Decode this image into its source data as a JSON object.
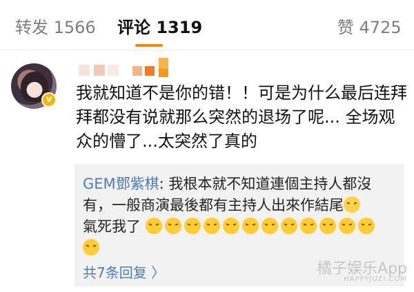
{
  "tabs": {
    "repost": "转发 1566",
    "comment": "评论 1319",
    "like": "赞 4725",
    "accent_color": "#ff8200"
  },
  "comment": {
    "avatar_icon": "user-avatar",
    "verified_badge": "v",
    "text": "我就知道不是你的错！！可是为什么最后连拜拜都没有说就那么突然的退场了呢... 全场观众的懵了...太突然了真的"
  },
  "reply": {
    "author": "GEM鄧紫棋",
    "separator": ":",
    "text": " 我根本就不知道連個主持人都沒有，一般商演最後都有主持人出來作結尾",
    "text_tail": "氣死我了",
    "emoji_count_line": 12,
    "more_replies": "共7条回复 〉",
    "link_color": "#4e7bb6"
  },
  "watermark": {
    "main": "橘子娱乐App",
    "sub": "HAPPYJUZI.COM"
  }
}
